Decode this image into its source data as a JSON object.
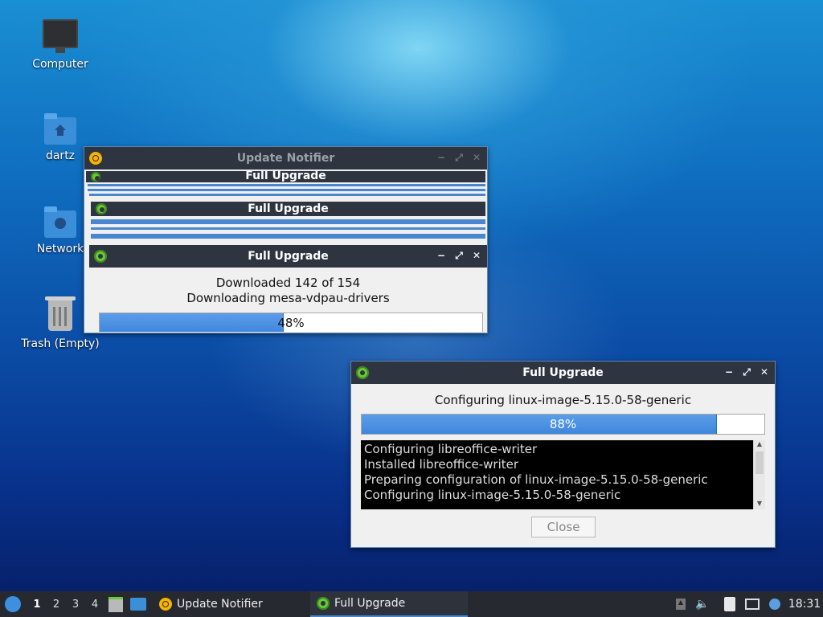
{
  "desktop": {
    "icons": [
      {
        "label": "Computer"
      },
      {
        "label": "dartz"
      },
      {
        "label": "Network"
      },
      {
        "label": "Trash (Empty)"
      }
    ]
  },
  "notifier_window": {
    "title": "Update Notifier",
    "ghost_titles": [
      "Full Upgrade",
      "Full Upgrade"
    ],
    "child": {
      "title": "Full Upgrade",
      "line1": "Downloaded 142 of 154",
      "line2": "Downloading mesa-vdpau-drivers",
      "progress_label": "48%",
      "progress": 0.48
    }
  },
  "upgrade_window": {
    "title": "Full Upgrade",
    "status": "Configuring linux-image-5.15.0-58-generic",
    "progress_label": "88%",
    "progress": 0.88,
    "log": [
      "Configuring libreoffice-writer",
      "Installed libreoffice-writer",
      "Preparing configuration of linux-image-5.15.0-58-generic",
      "Configuring linux-image-5.15.0-58-generic"
    ],
    "close_label": "Close"
  },
  "window_controls": {
    "minimize": "−",
    "maximize": "⤢",
    "close": "✕"
  },
  "taskbar": {
    "workspaces": [
      "1",
      "2",
      "3",
      "4"
    ],
    "tasks": [
      {
        "label": "Update Notifier"
      },
      {
        "label": "Full Upgrade"
      }
    ],
    "clock": "18:31"
  },
  "colors": {
    "accent": "#4a86d0",
    "titlebar": "#2f3540",
    "taskbar": "#262a30"
  }
}
